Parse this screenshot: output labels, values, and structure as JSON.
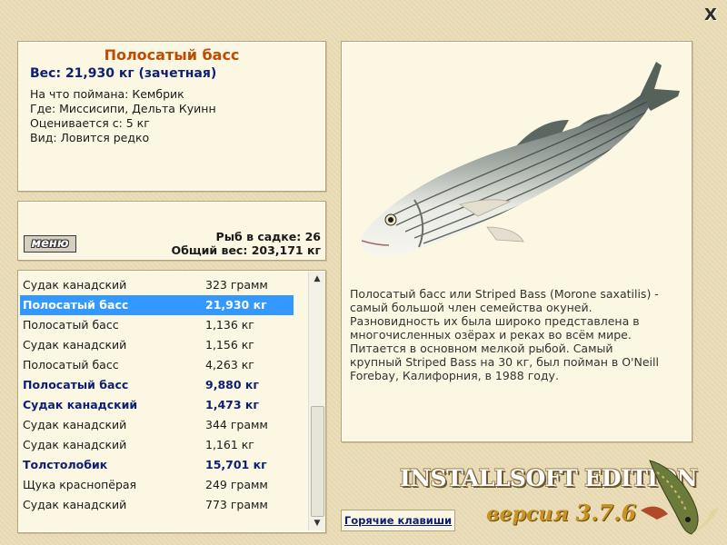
{
  "close_label": "X",
  "info": {
    "title": "Полосатый басс",
    "weight": "Вес: 21,930 кг (зачетная)",
    "caught_on": "На что поймана: Кембрик",
    "where": "Где: Миссисипи, Дельта Куинн",
    "rated_from": "Оценивается с: 5 кг",
    "kind": "Вид: Ловится редко"
  },
  "mid": {
    "menu_label": "меню",
    "fish_in_keepnet": "Рыб в садке: 26",
    "total_weight": "Общий вес: 203,171 кг"
  },
  "list": {
    "rows": [
      {
        "name": "Судак канадский",
        "weight": "323 грамм"
      },
      {
        "name": "Полосатый басс",
        "weight": "21,930 кг"
      },
      {
        "name": "Полосатый басс",
        "weight": "1,136 кг"
      },
      {
        "name": "Судак канадский",
        "weight": "1,156 кг"
      },
      {
        "name": "Полосатый басс",
        "weight": "4,263 кг"
      },
      {
        "name": "Полосатый басс",
        "weight": "9,880 кг"
      },
      {
        "name": "Судак канадский",
        "weight": "1,473 кг"
      },
      {
        "name": "Судак канадский",
        "weight": "344 грамм"
      },
      {
        "name": "Судак канадский",
        "weight": "1,161 кг"
      },
      {
        "name": "Толстолобик",
        "weight": "15,701 кг"
      },
      {
        "name": "Щука краснопёрая",
        "weight": "249 грамм"
      },
      {
        "name": "Судак канадский",
        "weight": "773 грамм"
      }
    ]
  },
  "description": "Полосатый басс или Striped Bass (Morone saxatilis) - самый большой член семейства окуней. Разновидность их была широко представлена в многочисленных озёрах и реках во всём мире. Питается в основном мелкой рыбой. Самый крупный Striped Bass на 30 кг, был пойман в O'Neill Forebay, Калифорния, в 1988 году.",
  "hotkeys_label": "Горячие клавиши",
  "edition": "INSTALLSOFT EDITION",
  "version_word": "версия",
  "version_number": "3.7.6",
  "colors": {
    "title": "#c24a00",
    "highlight_text": "#0d1f72",
    "selection": "#3399ff",
    "panel": "#fbf7e2",
    "background": "#eadcb6"
  }
}
